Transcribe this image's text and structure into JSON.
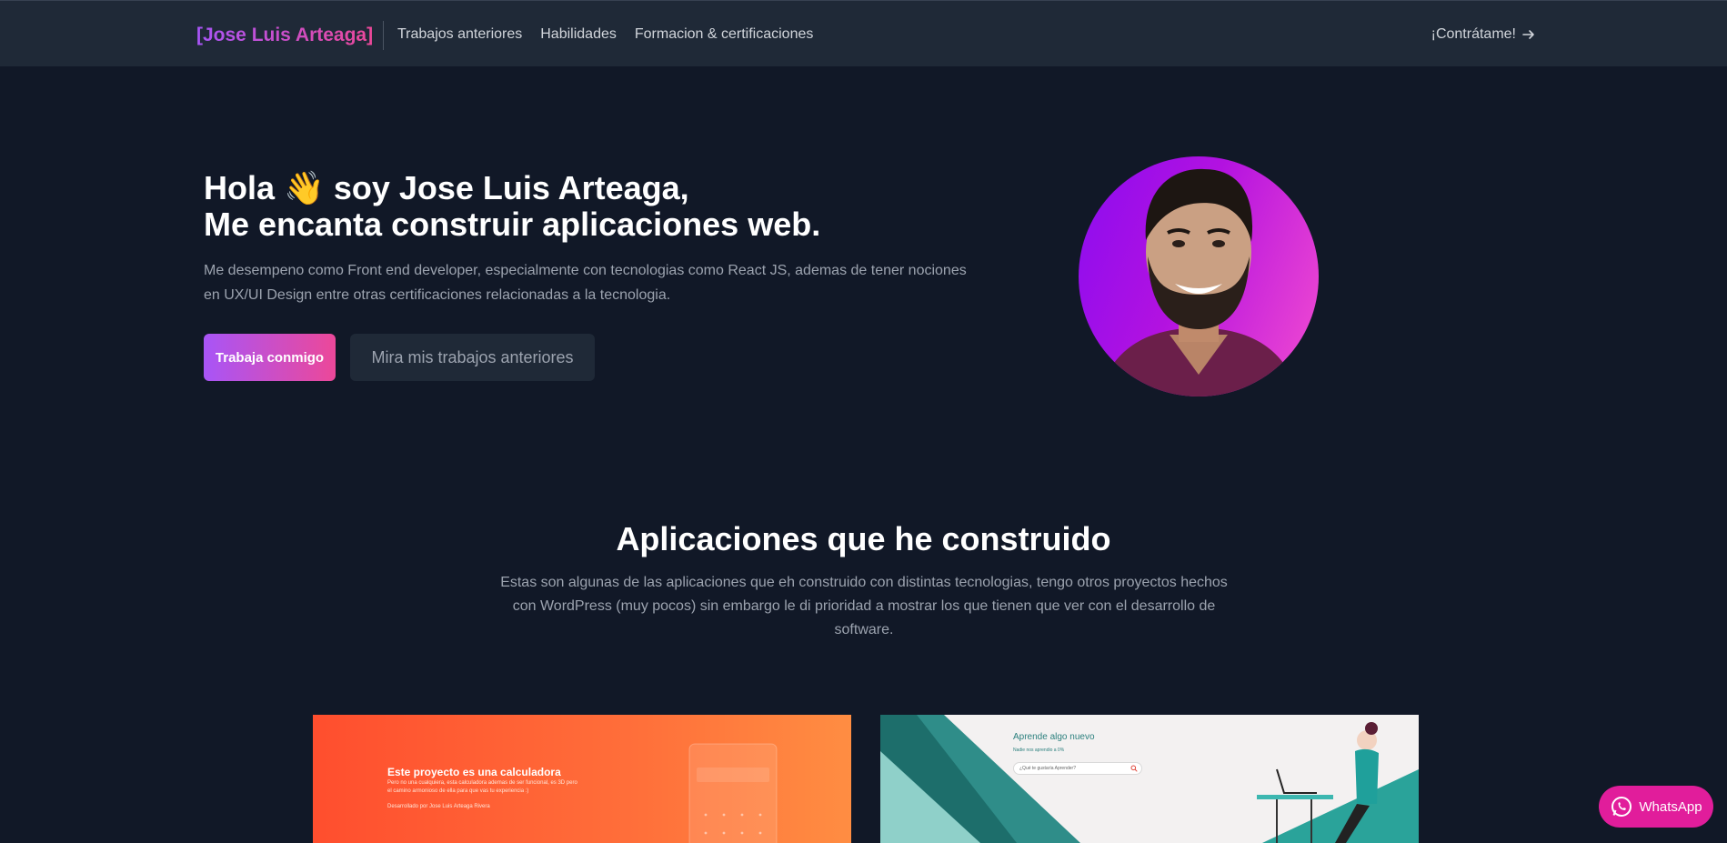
{
  "nav": {
    "brand": "[Jose Luis Arteaga]",
    "links": [
      "Trabajos anteriores",
      "Habilidades",
      "Formacion & certificaciones"
    ],
    "hire_label": "¡Contrátame!"
  },
  "hero": {
    "title_line1": "Hola 👋 soy Jose Luis Arteaga,",
    "title_line2": "Me encanta construir aplicaciones web.",
    "description": "Me desempeno como Front end developer, especialmente con tecnologias como React JS, ademas de tener nociones en UX/UI Design entre otras certificaciones relacionadas a la tecnologia.",
    "primary_button": "Trabaja conmigo",
    "secondary_button": "Mira mis trabajos anteriores"
  },
  "projects": {
    "title": "Aplicaciones que he construido",
    "description": "Estas son algunas de las aplicaciones que eh construido con distintas tecnologias, tengo otros proyectos hechos con WordPress (muy pocos) sin embargo le di prioridad a mostrar los que tienen que ver con el desarrollo de software.",
    "card1": {
      "heading": "Este proyecto es una calculadora",
      "text1": "Pero no una cualquiera, esta calculadora ademas de ser funcional, es 3D pero",
      "text2": "el camino armonioso de ella para que vas tu experiencia :)",
      "credit": "Desarrollado por Jose Luis Arteaga Rivera"
    },
    "card2": {
      "heading": "Aprende algo nuevo",
      "sub": "Nadie nos aprendio a 0%",
      "search_placeholder": "¿Qué te gustaría Aprender?"
    }
  },
  "whatsapp": {
    "label": "WhatsApp"
  },
  "colors": {
    "accent_start": "#a855f7",
    "accent_end": "#ec4899",
    "background": "#111827",
    "navbar": "#1f2937",
    "whatsapp": "#e11d9b"
  }
}
